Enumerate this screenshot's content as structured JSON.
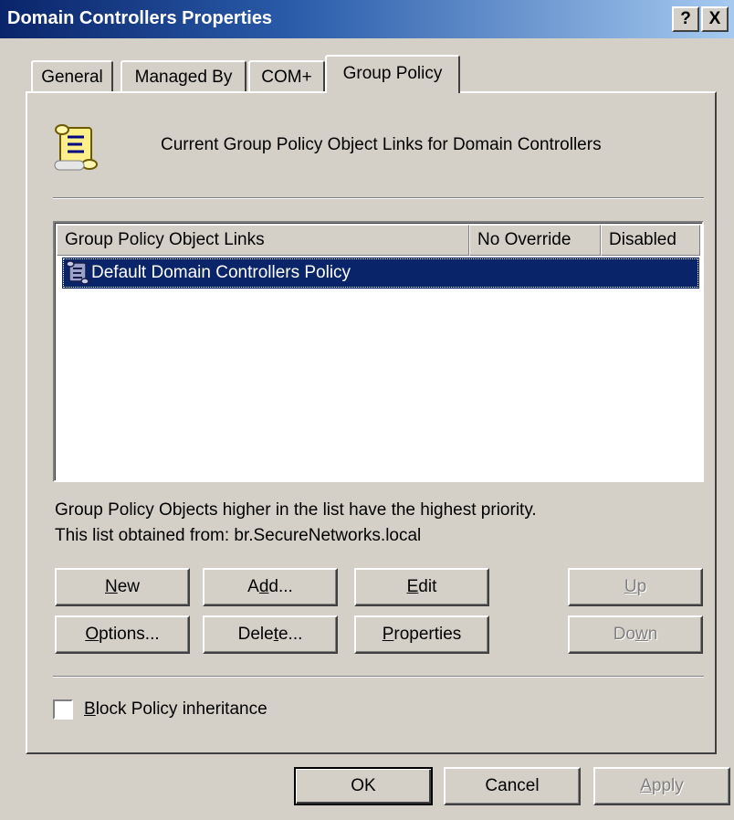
{
  "window": {
    "title": "Domain Controllers Properties",
    "help_label": "?",
    "close_label": "X"
  },
  "tabs": [
    {
      "label": "General"
    },
    {
      "label": "Managed By"
    },
    {
      "label": "COM+"
    },
    {
      "label": "Group Policy",
      "active": true
    }
  ],
  "header": {
    "icon": "scroll-icon",
    "text": "Current Group Policy Object Links for Domain Controllers"
  },
  "list": {
    "columns": [
      "Group Policy Object Links",
      "No Override",
      "Disabled"
    ],
    "rows": [
      {
        "name": "Default Domain Controllers Policy",
        "no_override": "",
        "disabled": "",
        "selected": true,
        "icon": "scroll-icon"
      }
    ]
  },
  "info": {
    "line1": "Group Policy Objects higher in the list have the highest priority.",
    "line2": "This list obtained from: br.SecureNetworks.local"
  },
  "buttons": {
    "new": {
      "pre": "",
      "key": "N",
      "post": "ew"
    },
    "add": {
      "pre": "A",
      "key": "d",
      "post": "d..."
    },
    "edit": {
      "pre": "",
      "key": "E",
      "post": "dit"
    },
    "up": {
      "pre": "",
      "key": "U",
      "post": "p"
    },
    "options": {
      "pre": "",
      "key": "O",
      "post": "ptions..."
    },
    "delete": {
      "pre": "Dele",
      "key": "t",
      "post": "e..."
    },
    "properties": {
      "pre": "",
      "key": "P",
      "post": "roperties"
    },
    "down": {
      "pre": "Do",
      "key": "w",
      "post": "n"
    }
  },
  "block_inheritance": {
    "pre": "",
    "key": "B",
    "post": "lock Policy inheritance",
    "checked": false
  },
  "footer": {
    "ok": "OK",
    "cancel": "Cancel",
    "apply": {
      "pre": "",
      "key": "A",
      "post": "pply"
    }
  },
  "colors": {
    "title_start": "#0a246a",
    "title_end": "#a6caf0",
    "face": "#d4d0c8",
    "selection": "#0a246a"
  }
}
